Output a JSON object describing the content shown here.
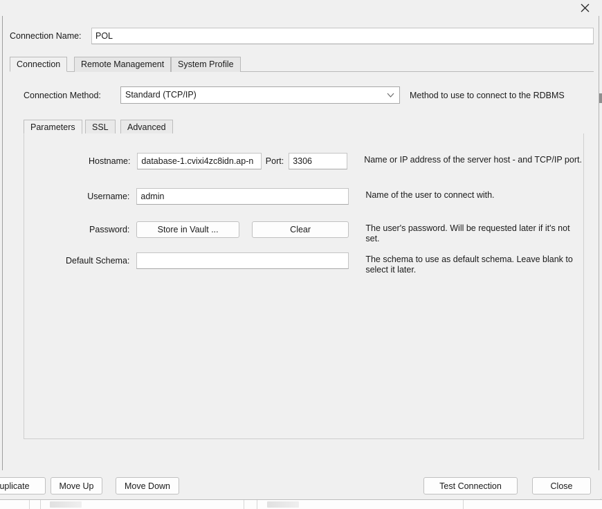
{
  "window": {
    "close_icon": "close-icon"
  },
  "connection_name": {
    "label": "Connection Name:",
    "value": "POL",
    "placeholder": ""
  },
  "outer_tabs": [
    {
      "label": "Connection",
      "active": true
    },
    {
      "label": "Remote Management",
      "active": false
    },
    {
      "label": "System Profile",
      "active": false
    }
  ],
  "connection_method": {
    "label": "Connection Method:",
    "value": "Standard (TCP/IP)",
    "arrow_icon": "chevron-down-icon",
    "hint": "Method to use to connect to the RDBMS"
  },
  "inner_tabs": [
    {
      "label": "Parameters",
      "active": true
    },
    {
      "label": "SSL",
      "active": false
    },
    {
      "label": "Advanced",
      "active": false
    }
  ],
  "parameters": {
    "hostname": {
      "label": "Hostname:",
      "value": "database-1.cvixi4zc8idn.ap-n",
      "help": "Name or IP address of the server host - and TCP/IP port."
    },
    "port": {
      "label": "Port:",
      "value": "3306"
    },
    "username": {
      "label": "Username:",
      "value": "admin",
      "help": "Name of the user to connect with."
    },
    "password": {
      "label": "Password:",
      "store_button": "Store in Vault ...",
      "clear_button": "Clear",
      "help": "The user's password. Will be requested later if it's not set."
    },
    "default_schema": {
      "label": "Default Schema:",
      "value": "",
      "placeholder": "",
      "help": "The schema to use as default schema. Leave blank to select it later."
    }
  },
  "bottom_bar": {
    "duplicate": "uplicate",
    "move_up": "Move Up",
    "move_down": "Move Down",
    "test_connection": "Test Connection",
    "close": "Close"
  }
}
